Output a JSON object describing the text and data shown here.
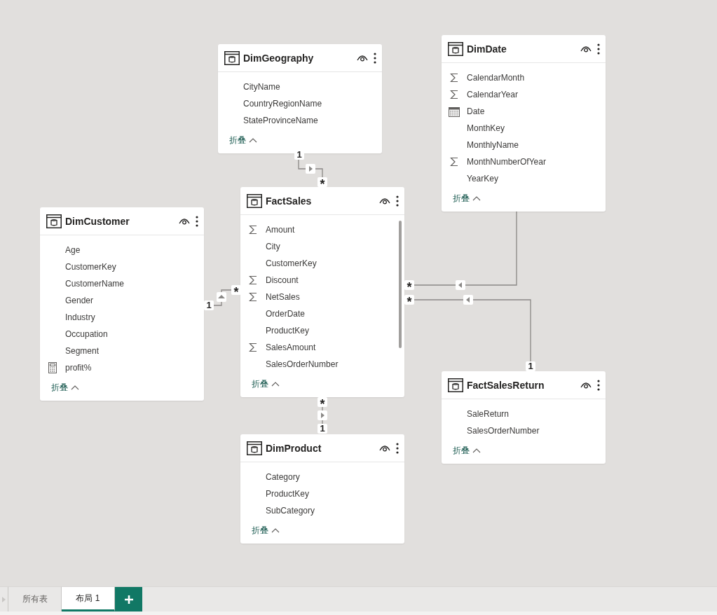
{
  "tables": [
    {
      "name": "DimGeography",
      "fields": [
        {
          "name": "CityName"
        },
        {
          "name": "CountryRegionName"
        },
        {
          "name": "StateProvinceName"
        }
      ],
      "collapse": "折叠"
    },
    {
      "name": "DimDate",
      "fields": [
        {
          "name": "CalendarMonth",
          "kind": "sum"
        },
        {
          "name": "CalendarYear",
          "kind": "sum"
        },
        {
          "name": "Date",
          "kind": "date"
        },
        {
          "name": "MonthKey"
        },
        {
          "name": "MonthlyName"
        },
        {
          "name": "MonthNumberOfYear",
          "kind": "sum"
        },
        {
          "name": "YearKey"
        }
      ],
      "collapse": "折叠"
    },
    {
      "name": "DimCustomer",
      "fields": [
        {
          "name": "Age"
        },
        {
          "name": "CustomerKey"
        },
        {
          "name": "CustomerName"
        },
        {
          "name": "Gender"
        },
        {
          "name": "Industry"
        },
        {
          "name": "Occupation"
        },
        {
          "name": "Segment"
        },
        {
          "name": "profit%",
          "kind": "measure"
        }
      ],
      "collapse": "折叠"
    },
    {
      "name": "FactSales",
      "scrollable": true,
      "fields": [
        {
          "name": "Amount",
          "kind": "sum"
        },
        {
          "name": "City"
        },
        {
          "name": "CustomerKey"
        },
        {
          "name": "Discount",
          "kind": "sum"
        },
        {
          "name": "NetSales",
          "kind": "sum"
        },
        {
          "name": "OrderDate"
        },
        {
          "name": "ProductKey"
        },
        {
          "name": "SalesAmount",
          "kind": "sum"
        },
        {
          "name": "SalesOrderNumber"
        }
      ],
      "collapse": "折叠"
    },
    {
      "name": "DimProduct",
      "fields": [
        {
          "name": "Category"
        },
        {
          "name": "ProductKey"
        },
        {
          "name": "SubCategory"
        }
      ],
      "collapse": "折叠"
    },
    {
      "name": "FactSalesReturn",
      "fields": [
        {
          "name": "SaleReturn"
        },
        {
          "name": "SalesOrderNumber"
        }
      ],
      "collapse": "折叠"
    }
  ],
  "relationships": [
    {
      "one_label": "1",
      "many_label": "*"
    },
    {
      "one_label": "1",
      "many_label": "*"
    },
    {
      "one_label": "1",
      "many_label": "*"
    },
    {
      "many_label": "*"
    },
    {
      "one_label": "1",
      "many_label": "*"
    }
  ],
  "tabs": [
    {
      "label": "所有表",
      "selected": false
    },
    {
      "label": "布局 1",
      "selected": true
    }
  ]
}
